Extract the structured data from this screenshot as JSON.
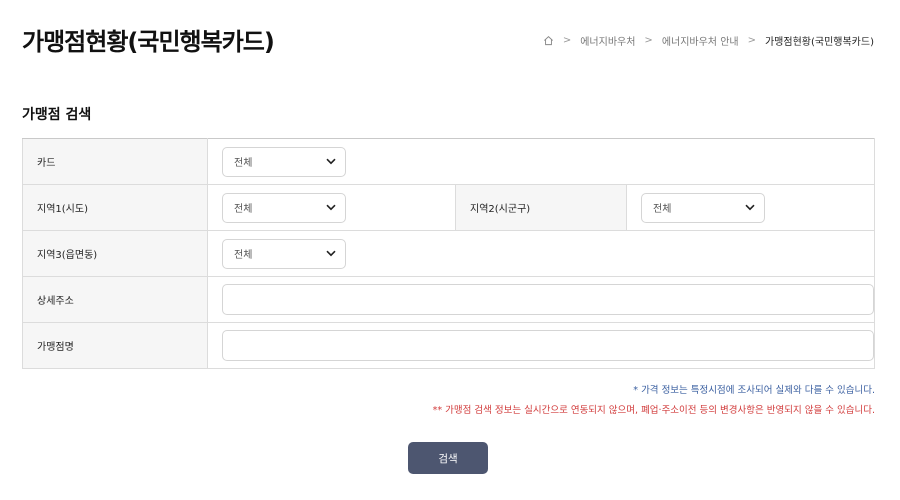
{
  "header": {
    "title": "가맹점현황(국민행복카드)",
    "breadcrumb": [
      "에너지바우처",
      "에너지바우처 안내",
      "가맹점현황(국민행복카드)"
    ]
  },
  "search": {
    "section_title": "가맹점 검색",
    "card": {
      "label": "카드",
      "selected": "전체"
    },
    "region1": {
      "label": "지역1(시도)",
      "selected": "전체"
    },
    "region2": {
      "label": "지역2(시군구)",
      "selected": "전체"
    },
    "region3": {
      "label": "지역3(읍면동)",
      "selected": "전체"
    },
    "address": {
      "label": "상세주소",
      "value": ""
    },
    "store_name": {
      "label": "가맹점명",
      "value": ""
    },
    "button_label": "검색"
  },
  "notes": {
    "price_note": "* 가격 정보는 특정시점에 조사되어 실제와 다를 수 있습니다.",
    "store_note": "** 가맹점 검색 정보는 실시간으로 연동되지 않으며, 폐업·주소이전 등의 변경사항은 반영되지 않을 수 있습니다."
  },
  "colors": {
    "button_bg": "#4d5670",
    "note_blue": "#3a5fa0",
    "note_red": "#d23c3c",
    "label_bg": "#f6f6f6"
  }
}
